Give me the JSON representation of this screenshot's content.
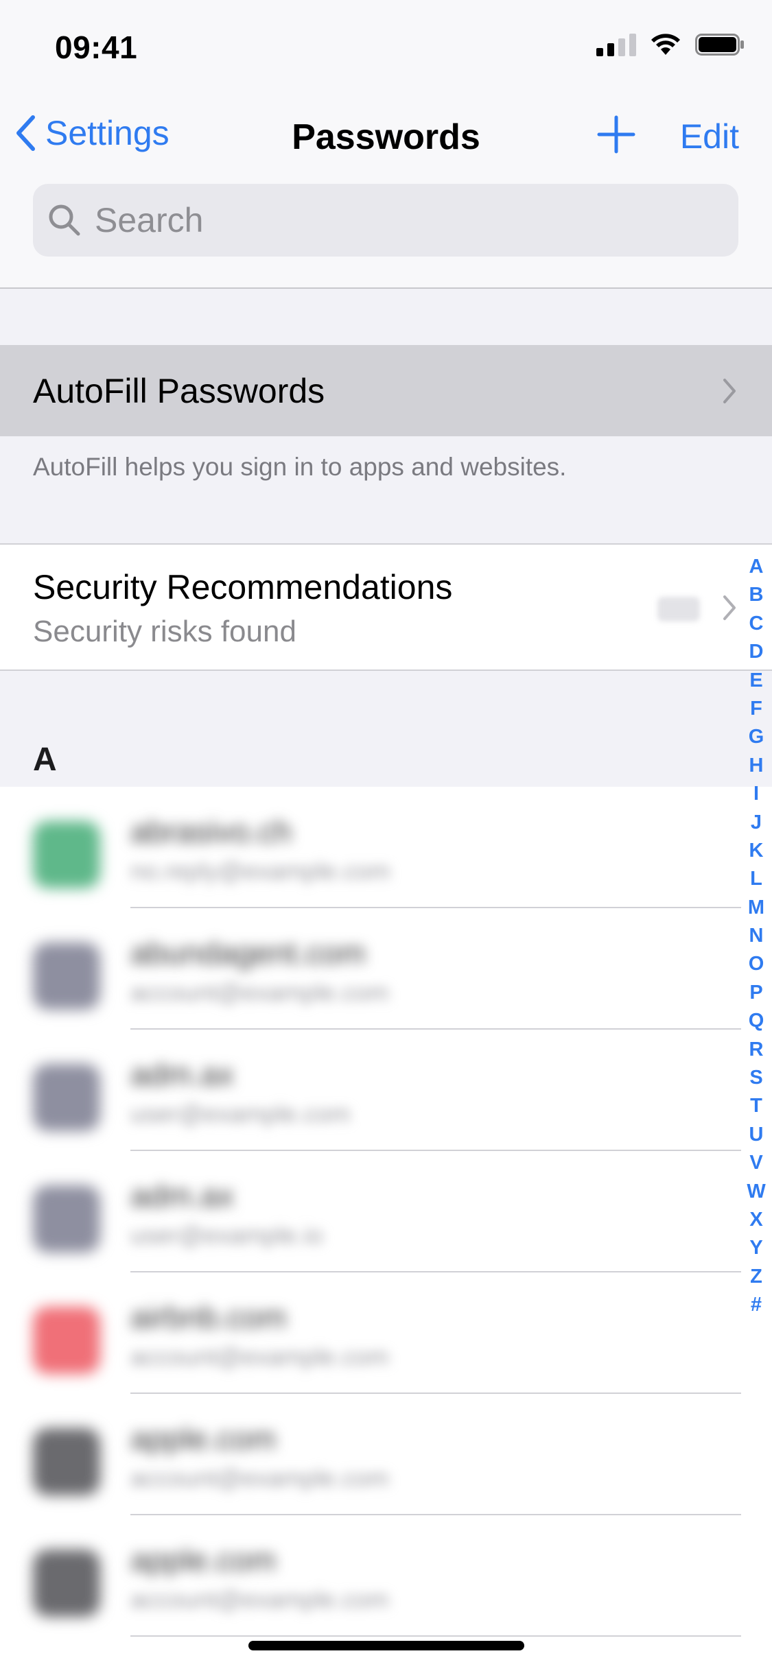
{
  "status_bar": {
    "time": "09:41",
    "icons": [
      "cellular-signal-icon",
      "wifi-icon",
      "battery-icon"
    ]
  },
  "nav": {
    "back_label": "Settings",
    "title": "Passwords",
    "add_icon": "plus-icon",
    "edit_label": "Edit"
  },
  "search": {
    "placeholder": "Search"
  },
  "autofill": {
    "label": "AutoFill Passwords",
    "footer": "AutoFill helps you sign in to apps and websites."
  },
  "security": {
    "title": "Security Recommendations",
    "subtitle": "Security risks found"
  },
  "section_header": "A",
  "password_items": [
    {
      "title": "abrasivo.ch",
      "subtitle": "no.reply@example.com",
      "icon_color": "#5fb88a"
    },
    {
      "title": "abundagent.com",
      "subtitle": "account@example.com",
      "icon_color": "#8e8fa0"
    },
    {
      "title": "adm.ax",
      "subtitle": "user@example.com",
      "icon_color": "#8e8fa0"
    },
    {
      "title": "adm.ax",
      "subtitle": "user@example.io",
      "icon_color": "#8e8fa0"
    },
    {
      "title": "airbnb.com",
      "subtitle": "account@example.com",
      "icon_color": "#f07078"
    },
    {
      "title": "apple.com",
      "subtitle": "account@example.com",
      "icon_color": "#6a6a6e"
    },
    {
      "title": "apple.com",
      "subtitle": "account@example.com",
      "icon_color": "#6a6a6e"
    }
  ],
  "index_letters": [
    "A",
    "B",
    "C",
    "D",
    "E",
    "F",
    "G",
    "H",
    "I",
    "J",
    "K",
    "L",
    "M",
    "N",
    "O",
    "P",
    "Q",
    "R",
    "S",
    "T",
    "U",
    "V",
    "W",
    "X",
    "Y",
    "Z",
    "#"
  ],
  "colors": {
    "accent": "#2f7bf0",
    "grouped_background": "#f2f2f7",
    "highlight_row": "#d1d1d6"
  }
}
